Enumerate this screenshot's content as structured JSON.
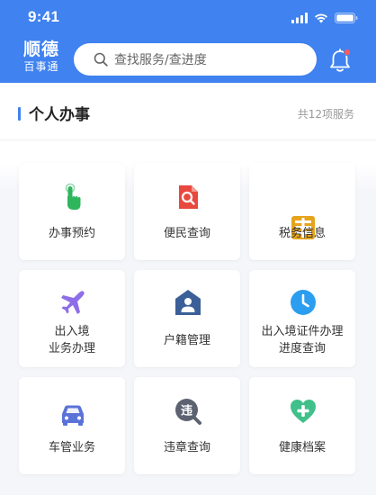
{
  "status_bar": {
    "time": "9:41"
  },
  "header": {
    "brand_main": "顺德",
    "brand_sub": "百事通",
    "search_placeholder": "查找服务/查进度"
  },
  "section": {
    "title": "个人办事",
    "count": "共12项服务"
  },
  "services": [
    {
      "label_lines": [
        "办事预约"
      ],
      "icon": "hand-tap-icon",
      "color": "#2fb65d"
    },
    {
      "label_lines": [
        "便民查询"
      ],
      "icon": "document-search-icon",
      "color": "#e8483e"
    },
    {
      "label_lines": [
        "税务信息"
      ],
      "icon": "tax-icon",
      "color": "#e6a41d"
    },
    {
      "label_lines": [
        "出入境",
        "业务办理"
      ],
      "icon": "airplane-icon",
      "color": "#8e6ee8"
    },
    {
      "label_lines": [
        "户籍管理"
      ],
      "icon": "house-person-icon",
      "color": "#3b5f97"
    },
    {
      "label_lines": [
        "出入境证件办理",
        "进度查询"
      ],
      "icon": "clock-icon",
      "color": "#2b9ef0"
    },
    {
      "label_lines": [
        "车管业务"
      ],
      "icon": "car-icon",
      "color": "#5b73d8"
    },
    {
      "label_lines": [
        "违章查询"
      ],
      "icon": "violation-search-icon",
      "color": "#5c6270"
    },
    {
      "label_lines": [
        "健康档案"
      ],
      "icon": "health-heart-icon",
      "color": "#40c08a"
    }
  ]
}
